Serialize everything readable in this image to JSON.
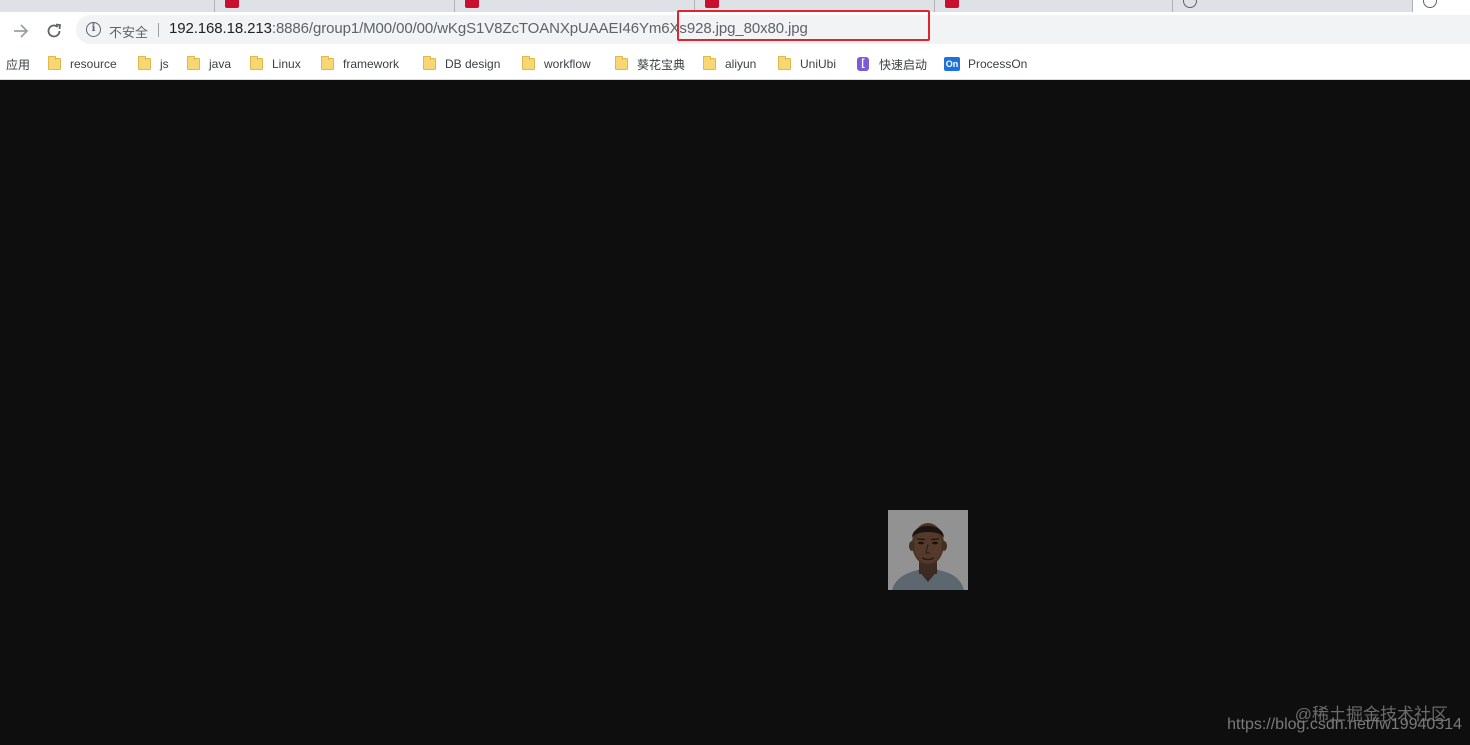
{
  "browser": {
    "security_label": "不安全",
    "url_host": "192.168.18.213",
    "url_path": ":8886/group1/M00/00/00/wKgS1V8ZcTOANXpUAAEI46Ym6Xs928.jpg_80x80.jpg"
  },
  "bookmarks": {
    "apps_label": "应用",
    "items": [
      {
        "label": "resource",
        "icon": "folder-icon"
      },
      {
        "label": "js",
        "icon": "folder-icon"
      },
      {
        "label": "java",
        "icon": "folder-icon"
      },
      {
        "label": "Linux",
        "icon": "folder-icon"
      },
      {
        "label": "framework",
        "icon": "folder-icon"
      },
      {
        "label": "DB design",
        "icon": "folder-icon"
      },
      {
        "label": "workflow",
        "icon": "folder-icon"
      },
      {
        "label": "葵花宝典",
        "icon": "folder-icon"
      },
      {
        "label": "aliyun",
        "icon": "folder-icon"
      },
      {
        "label": "UniUbi",
        "icon": "folder-icon"
      },
      {
        "label": "快速启动",
        "icon": "quick-launch-icon"
      },
      {
        "label": "ProcessOn",
        "icon": "processon-icon"
      }
    ]
  },
  "content": {
    "image_alt": "",
    "watermark": "@稀土掘金技术社区",
    "credit": "https://blog.csdn.net/fw19940314"
  },
  "colors": {
    "annotation_box": "#e0242c",
    "page_background": "#0e0e0e"
  }
}
